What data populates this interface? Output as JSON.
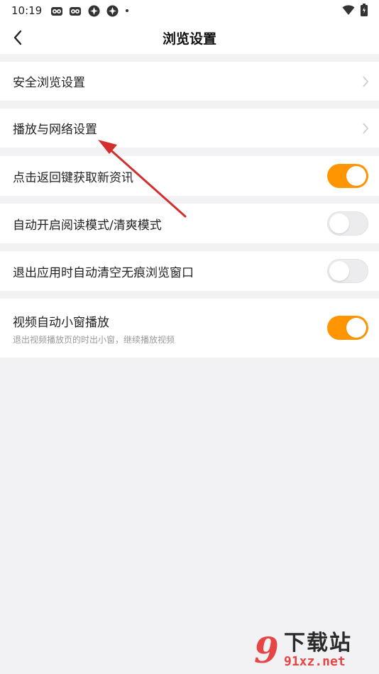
{
  "status_bar": {
    "time": "10:19"
  },
  "header": {
    "title": "浏览设置"
  },
  "settings": {
    "safe_browsing": {
      "label": "安全浏览设置"
    },
    "playback_network": {
      "label": "播放与网络设置"
    },
    "back_key_refresh": {
      "label": "点击返回键获取新资讯",
      "enabled": true
    },
    "auto_reading_mode": {
      "label": "自动开启阅读模式/清爽模式",
      "enabled": false
    },
    "clear_incognito_on_exit": {
      "label": "退出应用时自动清空无痕浏览窗口",
      "enabled": false
    },
    "video_mini_window": {
      "label": "视频自动小窗播放",
      "sublabel": "退出视频播放页的时出小窗，继续播放视频",
      "enabled": true
    }
  },
  "watermark": {
    "text": "下载站",
    "url": "91xz.net",
    "logo_glyph": "9"
  },
  "colors": {
    "accent": "#ff9500",
    "annotation_arrow": "#d32f2f"
  }
}
